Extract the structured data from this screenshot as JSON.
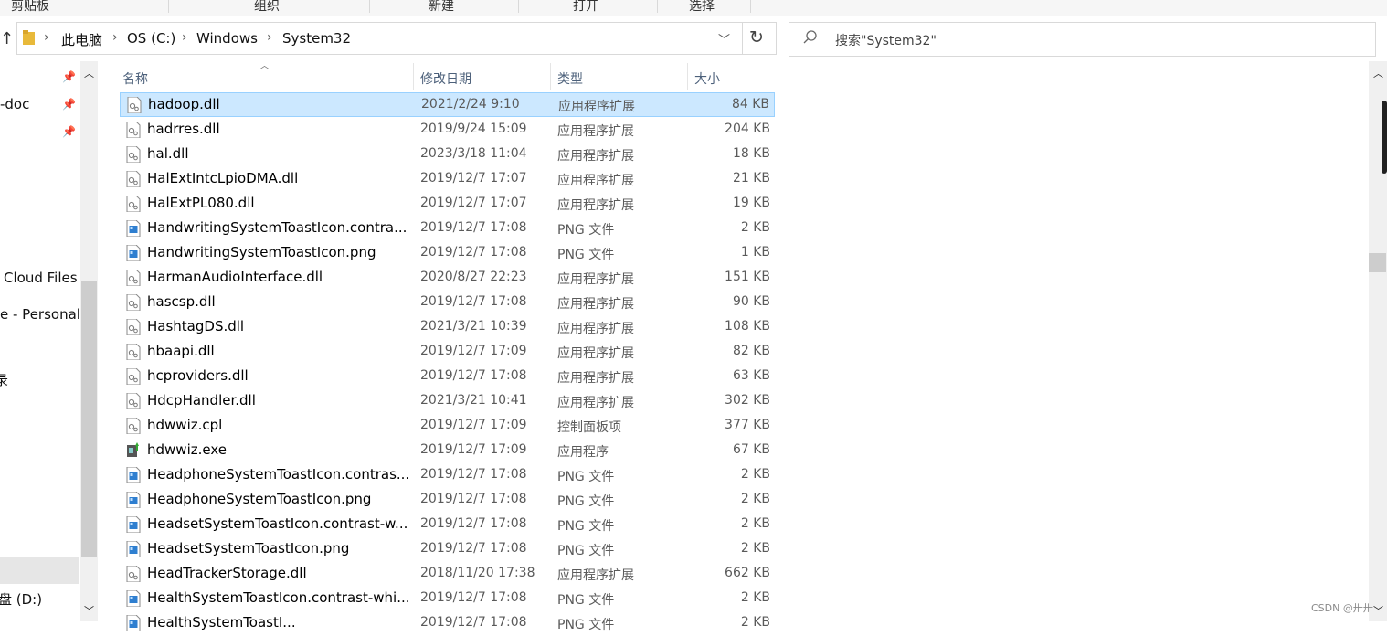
{
  "ribbon": {
    "groups": [
      "剪贴板",
      "组织",
      "新建",
      "打开",
      "选择"
    ]
  },
  "address": {
    "crumbs": [
      "此电脑",
      "OS (C:)",
      "Windows",
      "System32"
    ]
  },
  "search": {
    "placeholder": "搜索\"System32\""
  },
  "nav": {
    "items": [
      "-doc",
      "Cloud Files",
      "e - Personal",
      "录",
      "盘 (D:)"
    ]
  },
  "columns": {
    "name": "名称",
    "date": "修改日期",
    "type": "类型",
    "size": "大小"
  },
  "files": [
    {
      "name": "hadoop.dll",
      "date": "2021/2/24 9:10",
      "type": "应用程序扩展",
      "size": "84 KB",
      "icon": "dll",
      "selected": true
    },
    {
      "name": "hadrres.dll",
      "date": "2019/9/24 15:09",
      "type": "应用程序扩展",
      "size": "204 KB",
      "icon": "dll"
    },
    {
      "name": "hal.dll",
      "date": "2023/3/18 11:04",
      "type": "应用程序扩展",
      "size": "18 KB",
      "icon": "dll"
    },
    {
      "name": "HalExtIntcLpioDMA.dll",
      "date": "2019/12/7 17:07",
      "type": "应用程序扩展",
      "size": "21 KB",
      "icon": "dll"
    },
    {
      "name": "HalExtPL080.dll",
      "date": "2019/12/7 17:07",
      "type": "应用程序扩展",
      "size": "19 KB",
      "icon": "dll"
    },
    {
      "name": "HandwritingSystemToastIcon.contra...",
      "date": "2019/12/7 17:08",
      "type": "PNG 文件",
      "size": "2 KB",
      "icon": "png"
    },
    {
      "name": "HandwritingSystemToastIcon.png",
      "date": "2019/12/7 17:08",
      "type": "PNG 文件",
      "size": "1 KB",
      "icon": "png"
    },
    {
      "name": "HarmanAudioInterface.dll",
      "date": "2020/8/27 22:23",
      "type": "应用程序扩展",
      "size": "151 KB",
      "icon": "dll"
    },
    {
      "name": "hascsp.dll",
      "date": "2019/12/7 17:08",
      "type": "应用程序扩展",
      "size": "90 KB",
      "icon": "dll"
    },
    {
      "name": "HashtagDS.dll",
      "date": "2021/3/21 10:39",
      "type": "应用程序扩展",
      "size": "108 KB",
      "icon": "dll"
    },
    {
      "name": "hbaapi.dll",
      "date": "2019/12/7 17:09",
      "type": "应用程序扩展",
      "size": "82 KB",
      "icon": "dll"
    },
    {
      "name": "hcproviders.dll",
      "date": "2019/12/7 17:08",
      "type": "应用程序扩展",
      "size": "63 KB",
      "icon": "dll"
    },
    {
      "name": "HdcpHandler.dll",
      "date": "2021/3/21 10:41",
      "type": "应用程序扩展",
      "size": "302 KB",
      "icon": "dll"
    },
    {
      "name": "hdwwiz.cpl",
      "date": "2019/12/7 17:09",
      "type": "控制面板项",
      "size": "377 KB",
      "icon": "dll"
    },
    {
      "name": "hdwwiz.exe",
      "date": "2019/12/7 17:09",
      "type": "应用程序",
      "size": "67 KB",
      "icon": "exe"
    },
    {
      "name": "HeadphoneSystemToastIcon.contras...",
      "date": "2019/12/7 17:08",
      "type": "PNG 文件",
      "size": "2 KB",
      "icon": "png"
    },
    {
      "name": "HeadphoneSystemToastIcon.png",
      "date": "2019/12/7 17:08",
      "type": "PNG 文件",
      "size": "2 KB",
      "icon": "png"
    },
    {
      "name": "HeadsetSystemToastIcon.contrast-w...",
      "date": "2019/12/7 17:08",
      "type": "PNG 文件",
      "size": "2 KB",
      "icon": "png"
    },
    {
      "name": "HeadsetSystemToastIcon.png",
      "date": "2019/12/7 17:08",
      "type": "PNG 文件",
      "size": "2 KB",
      "icon": "png"
    },
    {
      "name": "HeadTrackerStorage.dll",
      "date": "2018/11/20 17:38",
      "type": "应用程序扩展",
      "size": "662 KB",
      "icon": "dll"
    },
    {
      "name": "HealthSystemToastIcon.contrast-whi...",
      "date": "2019/12/7 17:08",
      "type": "PNG 文件",
      "size": "2 KB",
      "icon": "png"
    },
    {
      "name": "HealthSystemToastI...",
      "date": "2019/12/7 17:08",
      "type": "PNG 文件",
      "size": "2 KB",
      "icon": "png"
    }
  ],
  "colors": {
    "selected_bg": "#cce8ff",
    "selected_border": "#99d1ff",
    "header_text": "#4c607a"
  },
  "watermark": "CSDN @卅卅"
}
